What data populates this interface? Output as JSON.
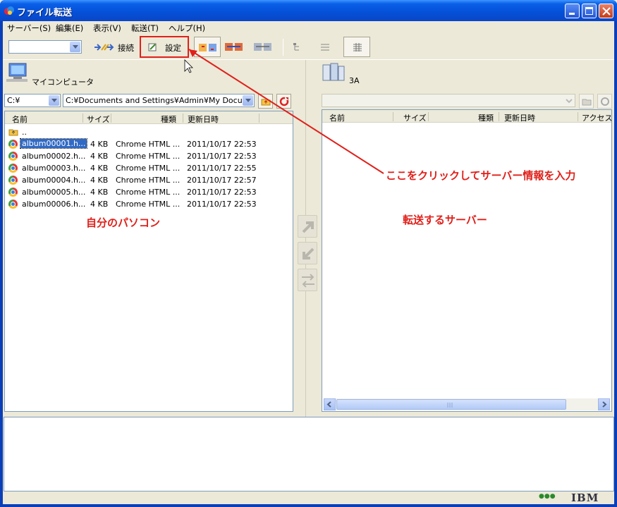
{
  "window": {
    "title": "ファイル転送"
  },
  "menu": [
    "サーバー(S)",
    "編集(E)",
    "表示(V)",
    "転送(T)",
    "ヘルプ(H)"
  ],
  "toolbar": {
    "connect_label": "接続",
    "settings_label": "設定"
  },
  "left": {
    "title": "マイコンピュータ",
    "drive": "C:¥",
    "path": "C:¥Documents and Settings¥Admin¥My Documer",
    "columns": [
      "名前",
      "サイズ",
      "種類",
      "更新日時"
    ],
    "parent": "..",
    "files": [
      {
        "name": "album00001.h...",
        "size": "4 KB",
        "type": "Chrome HTML ...",
        "date": "2011/10/17 22:53"
      },
      {
        "name": "album00002.h...",
        "size": "4 KB",
        "type": "Chrome HTML ...",
        "date": "2011/10/17 22:53"
      },
      {
        "name": "album00003.h...",
        "size": "4 KB",
        "type": "Chrome HTML ...",
        "date": "2011/10/17 22:55"
      },
      {
        "name": "album00004.h...",
        "size": "4 KB",
        "type": "Chrome HTML ...",
        "date": "2011/10/17 22:57"
      },
      {
        "name": "album00005.h...",
        "size": "4 KB",
        "type": "Chrome HTML ...",
        "date": "2011/10/17 22:53"
      },
      {
        "name": "album00006.h...",
        "size": "4 KB",
        "type": "Chrome HTML ...",
        "date": "2011/10/17 22:53"
      }
    ]
  },
  "right": {
    "title": "3A",
    "columns": [
      "名前",
      "サイズ",
      "種類",
      "更新日時",
      "アクセス権"
    ]
  },
  "annotations": {
    "click_here": "ここをクリックしてサーバー情報を入力",
    "my_pc": "自分のパソコン",
    "server": "転送するサーバー"
  },
  "status": {
    "brand": "IBM",
    "dots": "●●●"
  },
  "colors": {
    "annotation": "#e0201a",
    "titlebar": "#0450d6",
    "selection": "#316ac5"
  },
  "icons": [
    "computer-icon",
    "server-icon",
    "settings-icon",
    "connect-icon",
    "chrome-icon",
    "folder-up-icon",
    "refresh-icon",
    "upload-arrow-icon",
    "download-arrow-icon",
    "sync-icon"
  ]
}
